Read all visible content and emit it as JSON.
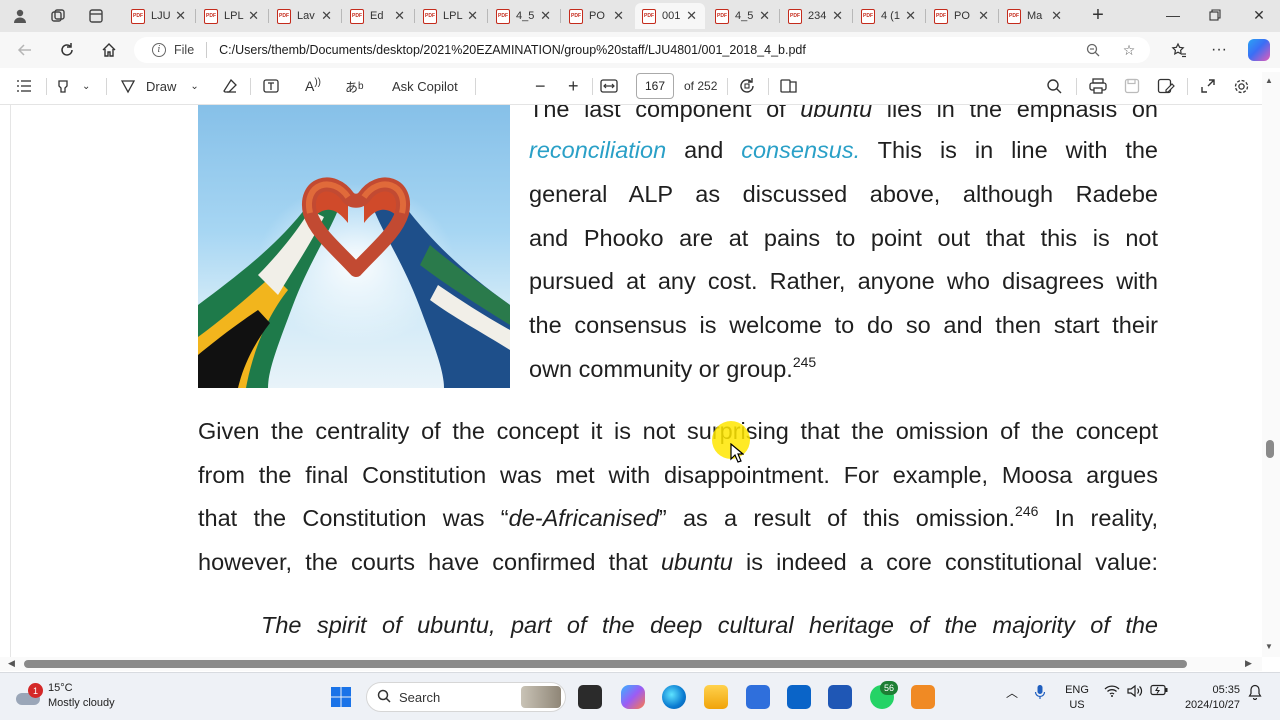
{
  "browser": {
    "tabs": [
      {
        "title": "LJU",
        "active": false
      },
      {
        "title": "LPL",
        "active": false
      },
      {
        "title": "Lav",
        "active": false
      },
      {
        "title": "Ed",
        "active": false
      },
      {
        "title": "LPL",
        "active": false
      },
      {
        "title": "4_5",
        "active": false
      },
      {
        "title": "PO",
        "active": false
      },
      {
        "title": "001",
        "active": true
      },
      {
        "title": "4_5",
        "active": false
      },
      {
        "title": "234",
        "active": false
      },
      {
        "title": "4 (1",
        "active": false
      },
      {
        "title": "PO",
        "active": false
      },
      {
        "title": "Ma",
        "active": false
      }
    ],
    "address": {
      "scheme_label": "File",
      "url": "C:/Users/themb/Documents/desktop/2021%20EZAMINATION/group%20staff/LJU4801/001_2018_4_b.pdf"
    }
  },
  "pdf_toolbar": {
    "draw_label": "Draw",
    "ask_copilot_label": "Ask Copilot",
    "page_current": "167",
    "page_total_label": "of 252"
  },
  "document": {
    "para1": {
      "line0": "The last component of ubuntu lies in the emphasis on",
      "line1_a": "reconciliation",
      "line1_b": " and ",
      "line1_c": "consensus.",
      "line1_d": " This is in line with the",
      "line2": "general ALP as discussed above, although Radebe",
      "line3": "and Phooko are at pains to point out that this is not",
      "line4": "pursued at any cost. Rather, anyone who disagrees with",
      "line5": "the consensus is welcome to do so and then start their",
      "line6": "own community or group.",
      "footnote": "245"
    },
    "para2": {
      "line1": "Given the centrality of the concept it is not surprising that the omission of the concept",
      "line2": "from the final Constitution was met with disappointment. For example, Moosa argues",
      "line3_a": "that the Constitution was “",
      "line3_b": "de-Africanised",
      "line3_c": "” as a result of this omission.",
      "line3_fn": "246",
      "line3_d": " In reality,",
      "line4_a": "however, the courts have confirmed that ",
      "line4_b": "ubuntu",
      "line4_c": " is indeed a core constitutional value:"
    },
    "quote": {
      "line1_a": "The spirit of ",
      "line1_b": "ubuntu",
      "line1_c": ", part of the deep cultural heritage of the majority of the"
    }
  },
  "taskbar": {
    "weather_temp": "15°C",
    "weather_desc": "Mostly cloudy",
    "weather_badge": "1",
    "search_placeholder": "Search",
    "whatsapp_badge": "56",
    "lang_line1": "ENG",
    "lang_line2": "US",
    "time": "05:35",
    "date": "2024/10/27"
  },
  "colors": {
    "highlight_text": "#2aa0c7",
    "pdf_icon": "#c42b1c",
    "cursor_highlight": "#ffe600"
  }
}
